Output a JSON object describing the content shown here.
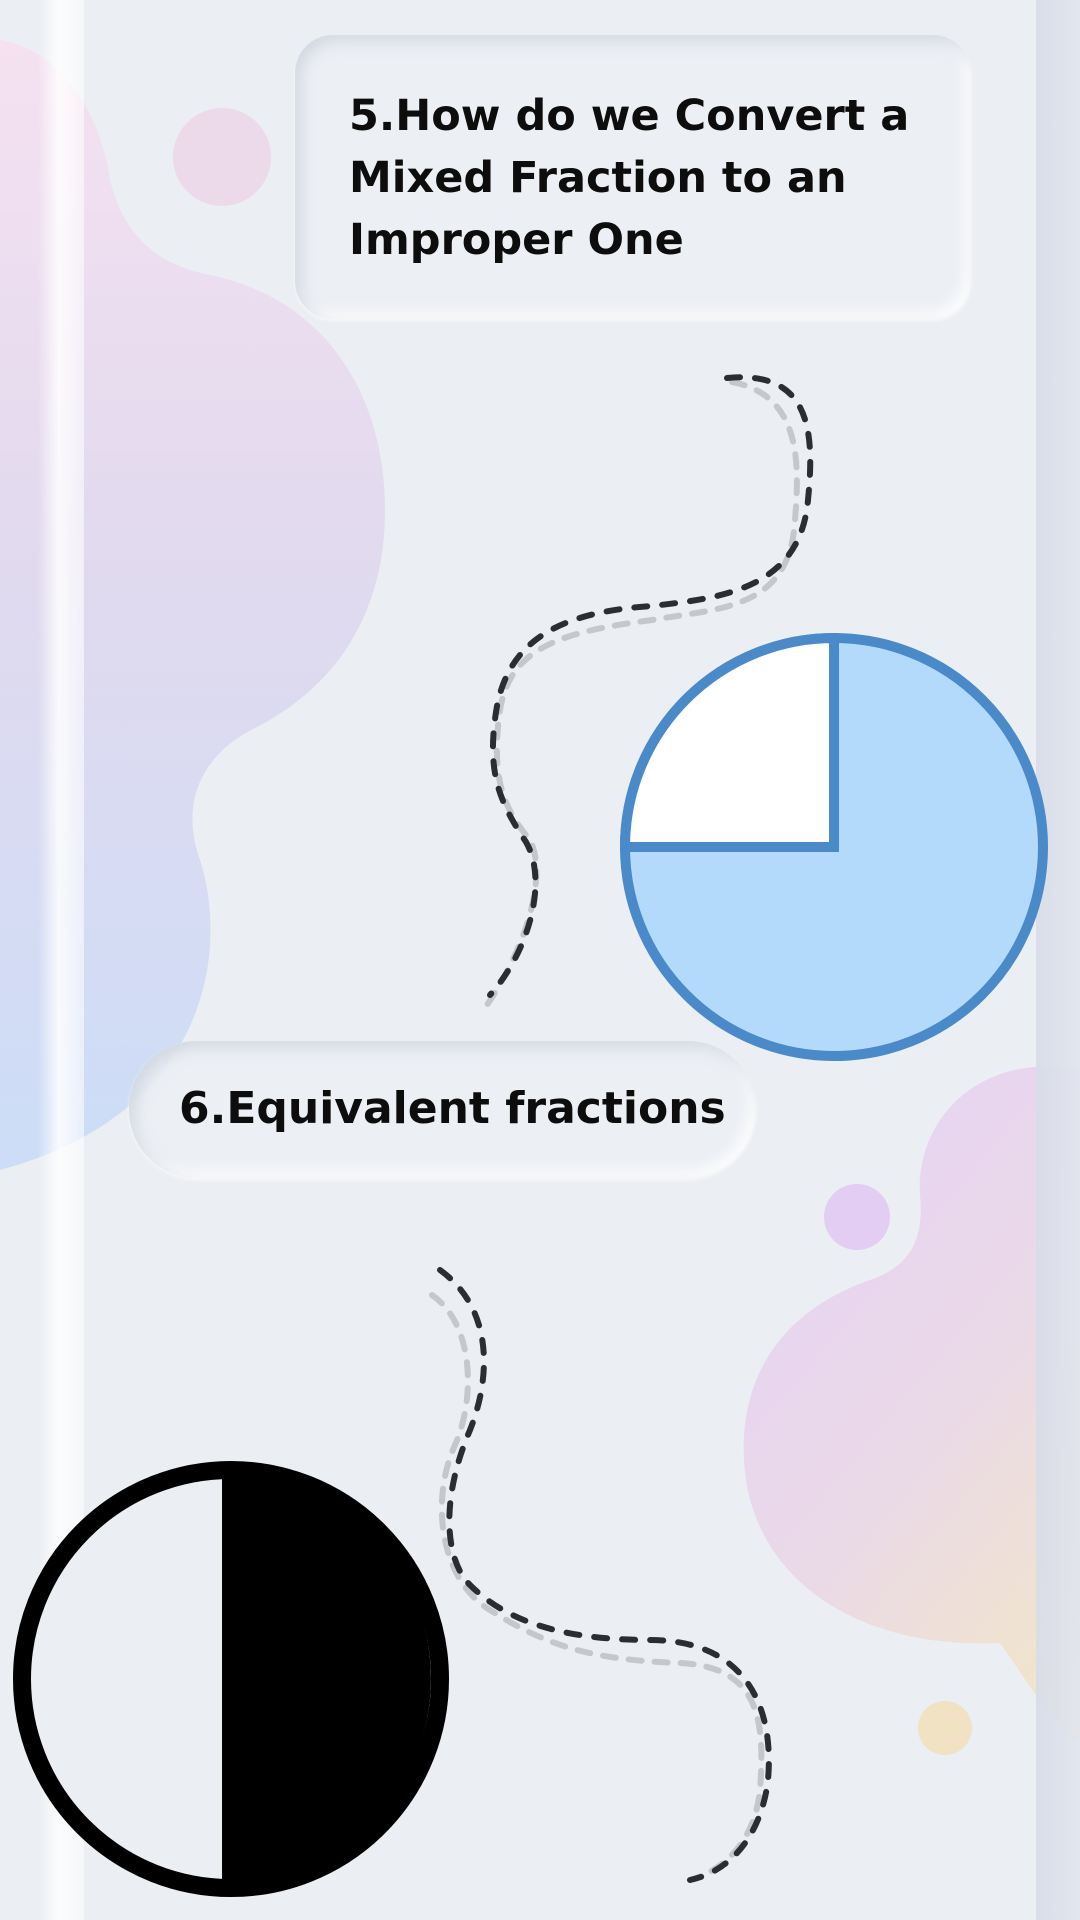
{
  "section5": {
    "title": "5.How do we Convert a Mixed Fraction to an Improper One"
  },
  "section6": {
    "title": "6.Equivalent fractions"
  },
  "figures": {
    "quarter_circle": {
      "icon": "three-quarters-fraction-icon",
      "fill_color": "#b3dafb",
      "stroke_color": "#4a8ac8",
      "empty_color": "#ffffff",
      "filled_fraction": 0.75
    },
    "half_circle": {
      "icon": "one-half-fraction-icon",
      "fill_color": "#000000",
      "empty_color": "#ebeef2",
      "filled_fraction": 0.5
    }
  },
  "colors": {
    "background": "#ebeef2",
    "blob_pink": "#f3dcec",
    "blob_blue": "#c4d7f7",
    "blob_purple": "#e4cdf5",
    "blob_peach": "#f1e2c8",
    "dash_dark": "#2b2d33",
    "dash_light": "#c5c7cb"
  }
}
